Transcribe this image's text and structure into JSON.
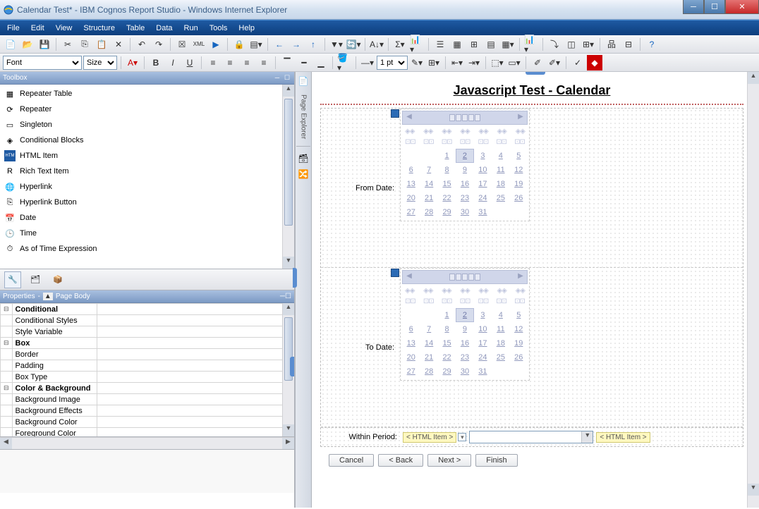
{
  "window": {
    "title": "Calendar Test* - IBM Cognos Report Studio - Windows Internet Explorer"
  },
  "menubar": [
    "File",
    "Edit",
    "View",
    "Structure",
    "Table",
    "Data",
    "Run",
    "Tools",
    "Help"
  ],
  "toolbar2": {
    "font_placeholder": "Font",
    "size_placeholder": "Size",
    "pt_value": "1 pt"
  },
  "toolbox": {
    "title": "Toolbox",
    "items": [
      {
        "icon": "repeater-table-icon",
        "glyph": "▦",
        "label": "Repeater Table"
      },
      {
        "icon": "repeater-icon",
        "glyph": "⟳",
        "label": "Repeater"
      },
      {
        "icon": "singleton-icon",
        "glyph": "▭",
        "label": "Singleton"
      },
      {
        "icon": "conditional-blocks-icon",
        "glyph": "◈",
        "label": "Conditional Blocks"
      },
      {
        "icon": "html-item-icon",
        "glyph": "HTM",
        "label": "HTML Item"
      },
      {
        "icon": "rich-text-icon",
        "glyph": "R",
        "label": "Rich Text Item"
      },
      {
        "icon": "hyperlink-icon",
        "glyph": "🌐",
        "label": "Hyperlink"
      },
      {
        "icon": "hyperlink-button-icon",
        "glyph": "⎘",
        "label": "Hyperlink Button"
      },
      {
        "icon": "date-icon",
        "glyph": "📅",
        "label": "Date"
      },
      {
        "icon": "time-icon",
        "glyph": "🕒",
        "label": "Time"
      },
      {
        "icon": "asof-time-icon",
        "glyph": "⏱",
        "label": "As of Time Expression"
      }
    ]
  },
  "properties": {
    "title": "Properties",
    "context": "Page Body",
    "groups": [
      {
        "name": "Conditional",
        "rows": [
          "Conditional Styles",
          "Style Variable"
        ]
      },
      {
        "name": "Box",
        "rows": [
          "Border",
          "Padding",
          "Box Type"
        ]
      },
      {
        "name": "Color & Background",
        "rows": [
          "Background Image",
          "Background Effects",
          "Background Color",
          "Foreground Color"
        ]
      }
    ]
  },
  "page_explorer": {
    "label": "Page Explorer"
  },
  "canvas": {
    "title": "Javascript Test - Calendar",
    "from_label": "From Date:",
    "to_label": "To Date:",
    "within_label": "Within Period:",
    "html_chip": "< HTML Item >",
    "cal_days_row1": [
      "",
      "",
      "1",
      "2",
      "3",
      "4",
      "5"
    ],
    "cal_days_row2": [
      "6",
      "7",
      "8",
      "9",
      "10",
      "11",
      "12"
    ],
    "cal_days_row3": [
      "13",
      "14",
      "15",
      "16",
      "17",
      "18",
      "19"
    ],
    "cal_days_row4": [
      "20",
      "21",
      "22",
      "23",
      "24",
      "25",
      "26"
    ],
    "cal_days_row5": [
      "27",
      "28",
      "29",
      "30",
      "31",
      "",
      ""
    ],
    "today": "2"
  },
  "wizard": {
    "cancel": "Cancel",
    "back": "< Back",
    "next": "Next >",
    "finish": "Finish"
  }
}
